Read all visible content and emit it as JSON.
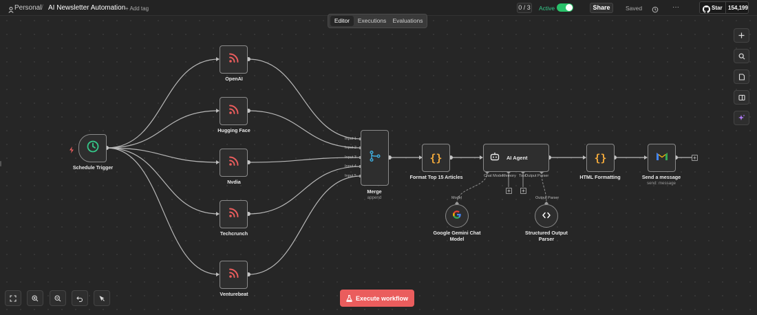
{
  "header": {
    "workspace": "Personal",
    "separator": "/",
    "workflow_name": "AI Newsletter Automation",
    "add_tag": "+ Add tag",
    "counter": "0 / 3",
    "active_label": "Active",
    "active": true,
    "share_label": "Share",
    "saved_label": "Saved",
    "more_label": "···",
    "github": {
      "star_label": "Star",
      "star_count": "154,199"
    }
  },
  "tabs": [
    {
      "label": "Editor",
      "active": true
    },
    {
      "label": "Executions",
      "active": false
    },
    {
      "label": "Evaluations",
      "active": false
    }
  ],
  "nodes": {
    "schedule_trigger": {
      "label": "Schedule Trigger",
      "icon": "clock-icon"
    },
    "rss_openai": {
      "label": "OpenAI",
      "icon": "rss-icon"
    },
    "rss_huggingface": {
      "label": "Hugging Face",
      "icon": "rss-icon"
    },
    "rss_nvidia": {
      "label": "Nvdia",
      "icon": "rss-icon"
    },
    "rss_techcrunch": {
      "label": "Techcrunch",
      "icon": "rss-icon"
    },
    "rss_venturebeat": {
      "label": "Venturebeat",
      "icon": "rss-icon"
    },
    "merge": {
      "label": "Merge",
      "subtitle": "append",
      "inputs": [
        "Input 1",
        "Input 2",
        "Input 3",
        "Input 4",
        "Input 5"
      ],
      "icon": "merge-icon"
    },
    "format": {
      "label": "Format Top 15 Articles",
      "icon": "code-braces-icon"
    },
    "ai_agent": {
      "label": "AI Agent",
      "icon": "robot-icon",
      "ports": [
        "Chat Model",
        "Memory",
        "Tool",
        "Output Parser"
      ]
    },
    "html_formatting": {
      "label": "HTML Formatting",
      "icon": "code-braces-icon"
    },
    "send_message": {
      "label": "Send a message",
      "subtitle": "send: message",
      "icon": "gmail-icon"
    },
    "gemini": {
      "label": "Google Gemini Chat Model",
      "line1": "Google Gemini Chat",
      "line2": "Model",
      "top_label": "Model",
      "icon": "google-icon"
    },
    "parser": {
      "label": "Structured Output Parser",
      "line1": "Structured Output",
      "line2": "Parser",
      "top_label": "Output Parser",
      "icon": "code-tags-icon"
    }
  },
  "execute_button": {
    "label": "Execute workflow"
  },
  "colors": {
    "accent": "#ea5d5d",
    "rss": "#ea5d5d",
    "clock": "#35c98a",
    "merge": "#3fa9d8",
    "braces": "#f2a93b",
    "active": "#29c26a"
  }
}
